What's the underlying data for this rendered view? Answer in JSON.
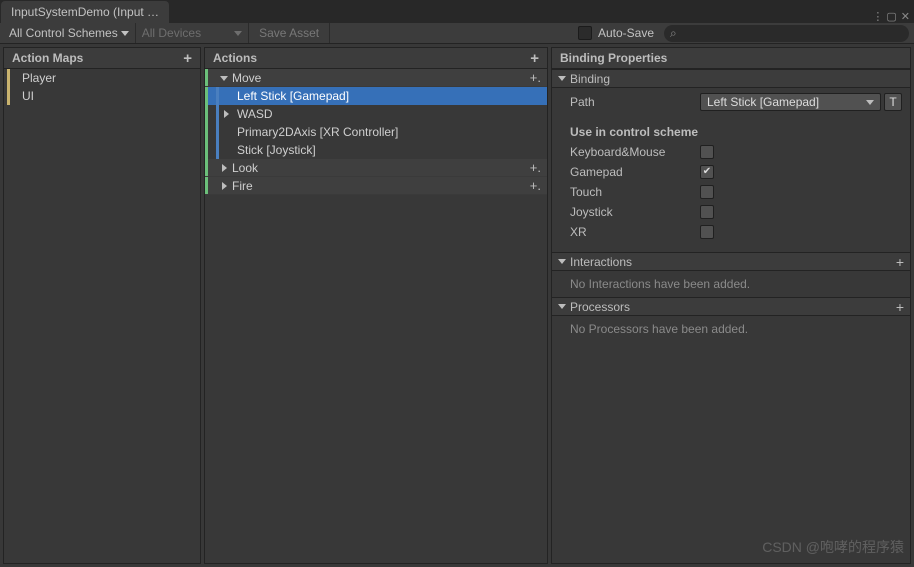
{
  "tab": {
    "title": "InputSystemDemo (Input …"
  },
  "toolbar": {
    "schemes_label": "All Control Schemes",
    "devices_label": "All Devices",
    "save_label": "Save Asset",
    "autosave_label": "Auto-Save"
  },
  "columns": {
    "maps_header": "Action Maps",
    "actions_header": "Actions",
    "props_header": "Binding Properties"
  },
  "action_maps": [
    {
      "label": "Player"
    },
    {
      "label": "UI"
    }
  ],
  "actions": [
    {
      "label": "Move",
      "expanded": true,
      "addable": true,
      "bindings": [
        {
          "label": "Left Stick [Gamepad]",
          "selected": true,
          "composite": false
        },
        {
          "label": "WASD",
          "composite": true
        },
        {
          "label": "Primary2DAxis [XR Controller]",
          "composite": false
        },
        {
          "label": "Stick [Joystick]",
          "composite": false
        }
      ]
    },
    {
      "label": "Look",
      "expanded": false,
      "addable": true,
      "bindings": []
    },
    {
      "label": "Fire",
      "expanded": false,
      "addable": true,
      "bindings": []
    }
  ],
  "binding_panel": {
    "section_binding": "Binding",
    "path_label": "Path",
    "path_value": "Left Stick [Gamepad]",
    "tbtn_label": "T",
    "use_in_scheme": "Use in control scheme",
    "schemes": [
      {
        "name": "Keyboard&Mouse",
        "checked": false
      },
      {
        "name": "Gamepad",
        "checked": true
      },
      {
        "name": "Touch",
        "checked": false
      },
      {
        "name": "Joystick",
        "checked": false
      },
      {
        "name": "XR",
        "checked": false
      }
    ],
    "interactions_header": "Interactions",
    "interactions_empty": "No Interactions have been added.",
    "processors_header": "Processors",
    "processors_empty": "No Processors have been added."
  },
  "watermark": "CSDN @咆哮的程序猿"
}
